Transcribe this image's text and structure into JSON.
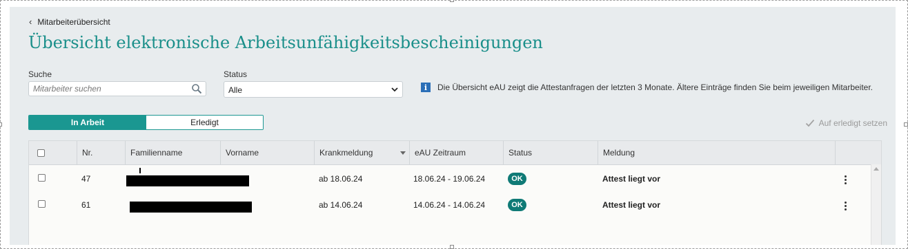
{
  "nav": {
    "back_label": "Mitarbeiterübersicht"
  },
  "page": {
    "title": "Übersicht elektronische Arbeitsunfähigkeitsbescheinigungen"
  },
  "filters": {
    "search_label": "Suche",
    "search_placeholder": "Mitarbeiter suchen",
    "status_label": "Status",
    "status_value": "Alle",
    "info_text": "Die Übersicht eAU zeigt die Attestanfragen der letzten 3 Monate. Ältere Einträge finden Sie beim jeweiligen Mitarbeiter."
  },
  "tabs": {
    "active": "In Arbeit",
    "inactive": "Erledigt"
  },
  "actions": {
    "set_done": "Auf erledigt setzen"
  },
  "table": {
    "headers": {
      "nr": "Nr.",
      "family": "Familienname",
      "first": "Vorname",
      "sick": "Krankmeldung",
      "period": "eAU Zeitraum",
      "status": "Status",
      "message": "Meldung"
    },
    "rows": [
      {
        "nr": "47",
        "sick": "ab 18.06.24",
        "period": "18.06.24 - 19.06.24",
        "status": "OK",
        "message": "Attest liegt vor"
      },
      {
        "nr": "61",
        "sick": "ab 14.06.24",
        "period": "14.06.24 - 14.06.24",
        "status": "OK",
        "message": "Attest liegt vor"
      }
    ]
  },
  "icons": {
    "back": "chevron-left-icon",
    "search": "search-icon",
    "dropdown": "chevron-down-icon",
    "info": "info-icon",
    "check": "check-icon",
    "menu": "kebab-menu-icon"
  },
  "colors": {
    "accent": "#1a9791",
    "title": "#1a8f8a",
    "badge": "#0f7a76",
    "info": "#2b6fb7"
  }
}
